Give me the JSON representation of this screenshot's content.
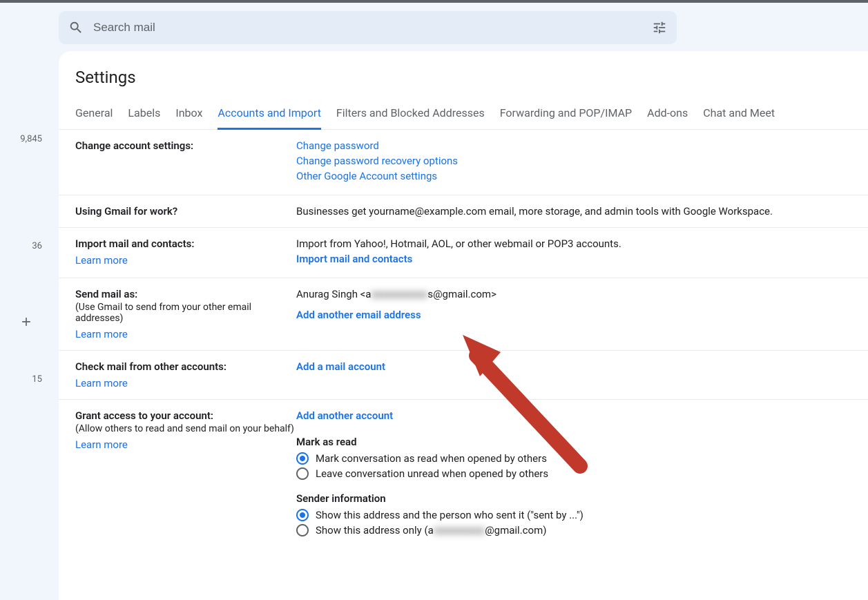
{
  "search": {
    "placeholder": "Search mail"
  },
  "sidebar": {
    "count1": "9,845",
    "count2": "36",
    "count3": "15"
  },
  "page_title": "Settings",
  "tabs": [
    {
      "label": "General"
    },
    {
      "label": "Labels"
    },
    {
      "label": "Inbox"
    },
    {
      "label": "Accounts and Import"
    },
    {
      "label": "Filters and Blocked Addresses"
    },
    {
      "label": "Forwarding and POP/IMAP"
    },
    {
      "label": "Add-ons"
    },
    {
      "label": "Chat and Meet"
    }
  ],
  "sections": {
    "change_account": {
      "title": "Change account settings:",
      "links": {
        "pw": "Change password",
        "recovery": "Change password recovery options",
        "other": "Other Google Account settings"
      }
    },
    "work": {
      "title": "Using Gmail for work?",
      "text": "Businesses get yourname@example.com email, more storage, and admin tools with Google Workspace."
    },
    "import": {
      "title": "Import mail and contacts:",
      "learn": "Learn more",
      "text": "Import from Yahoo!, Hotmail, AOL, or other webmail or POP3 accounts.",
      "link": "Import mail and contacts"
    },
    "send_as": {
      "title": "Send mail as:",
      "sub": "(Use Gmail to send from your other email addresses)",
      "learn": "Learn more",
      "name_prefix": "Anurag Singh <a",
      "blurred": "xxxxxxxxxxx",
      "name_suffix": "s@gmail.com>",
      "link": "Add another email address"
    },
    "check_mail": {
      "title": "Check mail from other accounts:",
      "learn": "Learn more",
      "link": "Add a mail account"
    },
    "grant": {
      "title": "Grant access to your account:",
      "sub": "(Allow others to read and send mail on your behalf)",
      "learn": "Learn more",
      "link": "Add another account",
      "mark_head": "Mark as read",
      "mark_opt1": "Mark conversation as read when opened by others",
      "mark_opt2": "Leave conversation unread when opened by others",
      "sender_head": "Sender information",
      "sender_opt1": "Show this address and the person who sent it (\"sent by ...\")",
      "sender_opt2_pre": "Show this address only (a",
      "sender_opt2_blur": "xxxxxxxxxx",
      "sender_opt2_post": "@gmail.com)"
    }
  }
}
